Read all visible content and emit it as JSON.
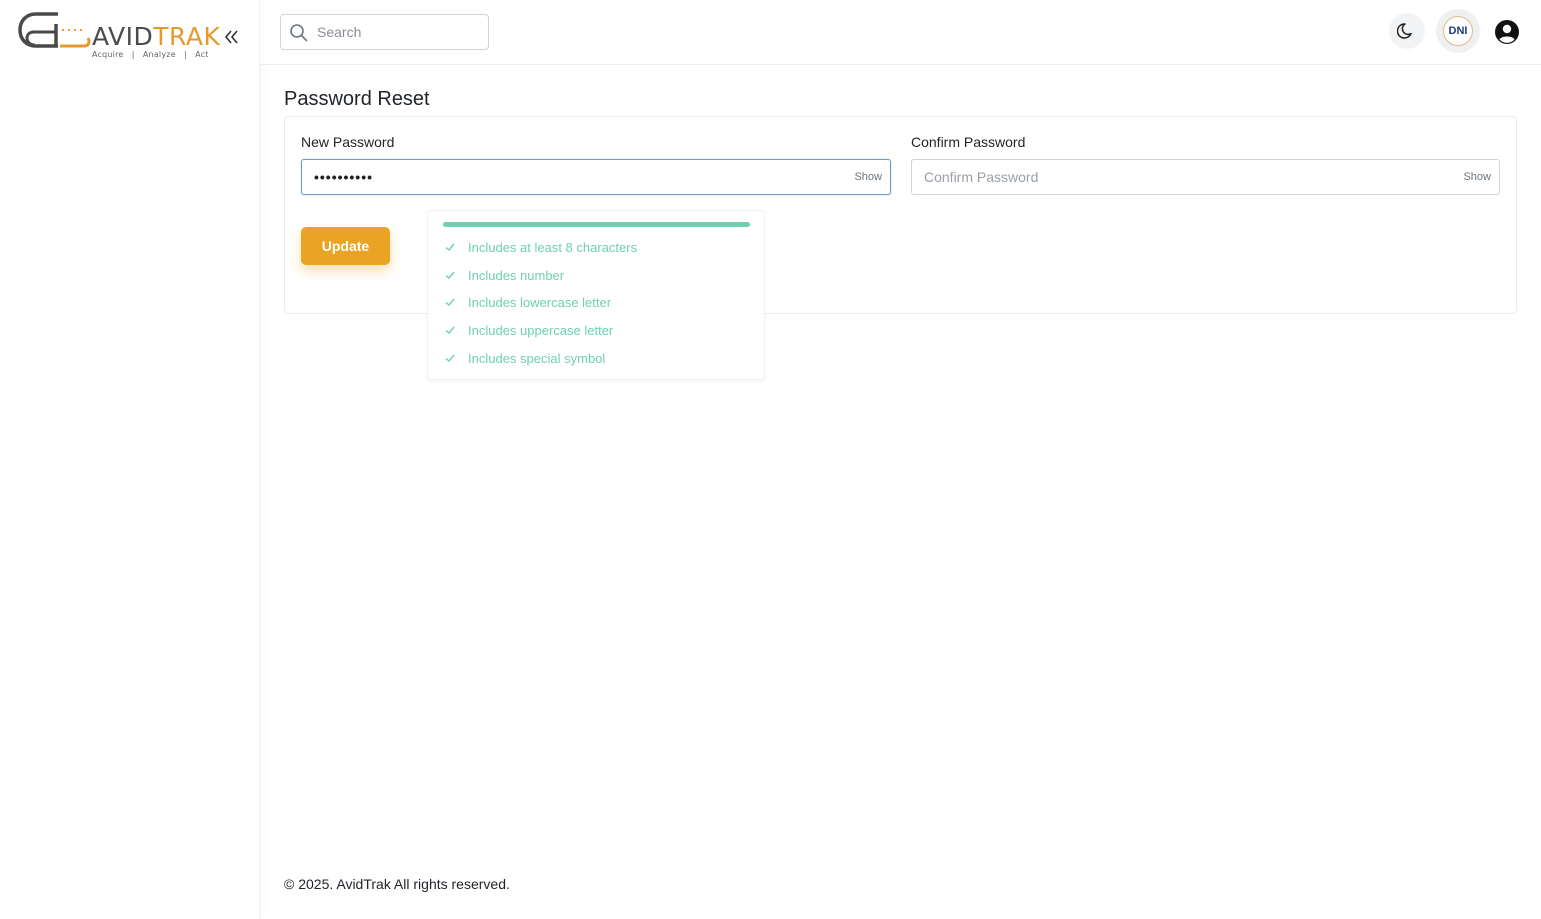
{
  "brand": {
    "name_part1": "AVID",
    "name_part2": "TRAK",
    "tagline": "Acquire   |   Analyze   |   Act",
    "accent_color": "#e69a2e"
  },
  "sidebar": {
    "collapse_icon": "double-chevron-left-icon"
  },
  "header": {
    "search_placeholder": "Search",
    "theme_icon": "moon-icon",
    "org_logo_text": "DNI",
    "user_icon": "user-circle-icon"
  },
  "page": {
    "title": "Password Reset"
  },
  "form": {
    "new_password": {
      "label": "New Password",
      "value": "••••••••••",
      "toggle": "Show"
    },
    "confirm_password": {
      "label": "Confirm Password",
      "placeholder": "Confirm Password",
      "value": "",
      "toggle": "Show"
    },
    "submit_label": "Update",
    "submit_color": "#eba324"
  },
  "strength": {
    "color": "#6fcfae",
    "rules": [
      {
        "label": "Includes at least 8 characters",
        "met": true
      },
      {
        "label": "Includes number",
        "met": true
      },
      {
        "label": "Includes lowercase letter",
        "met": true
      },
      {
        "label": "Includes uppercase letter",
        "met": true
      },
      {
        "label": "Includes special symbol",
        "met": true
      }
    ]
  },
  "footer": {
    "text": "© 2025. AvidTrak All rights reserved."
  }
}
